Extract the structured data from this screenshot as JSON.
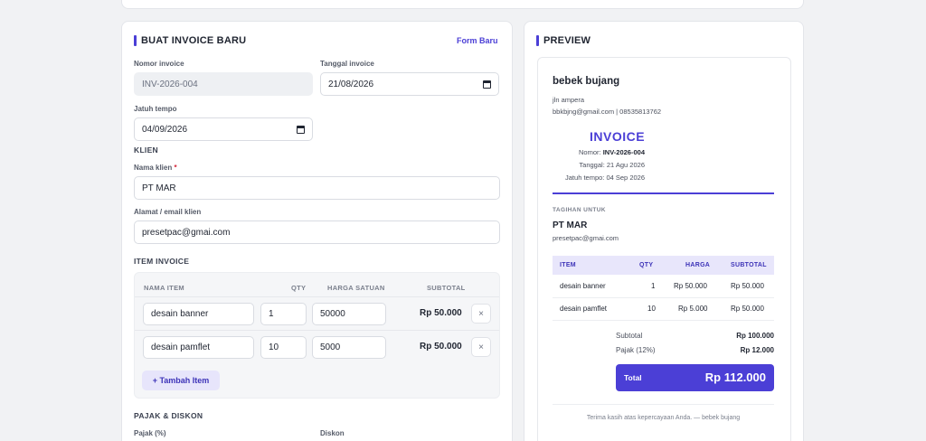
{
  "form": {
    "title": "BUAT INVOICE BARU",
    "new_form_label": "Form Baru",
    "invoice_number_label": "Nomor invoice",
    "invoice_number_value": "INV-2026-004",
    "invoice_date_label": "Tanggal invoice",
    "invoice_date_value": "21/08/2026",
    "due_date_label": "Jatuh tempo",
    "due_date_value": "04/09/2026",
    "client_section": "KLIEN",
    "client_name_label": "Nama klien",
    "required_mark": "*",
    "client_name_value": "PT MAR",
    "client_address_label": "Alamat / email klien",
    "client_address_value": "presetpac@gmai.com",
    "items_section": "ITEM INVOICE",
    "items_headers": {
      "name": "NAMA ITEM",
      "qty": "QTY",
      "price": "HARGA SATUAN",
      "subtotal": "SUBTOTAL"
    },
    "items": [
      {
        "name": "desain banner",
        "qty": "1",
        "price": "50000",
        "subtotal": "Rp 50.000"
      },
      {
        "name": "desain pamflet",
        "qty": "10",
        "price": "5000",
        "subtotal": "Rp 50.000"
      }
    ],
    "remove_symbol": "×",
    "add_item_label": "+ Tambah Item",
    "tax_section": "PAJAK & DISKON",
    "tax_label": "Pajak (%)",
    "discount_label": "Diskon"
  },
  "preview": {
    "title": "PREVIEW",
    "business_name": "bebek bujang",
    "business_address": "jln ampera",
    "business_contact": "bbkbjng@gmail.com | 08535813762",
    "invoice_heading": "INVOICE",
    "number_label": "Nomor:",
    "number_value": "INV-2026-004",
    "date_line": "Tanggal: 21 Agu 2026",
    "due_line": "Jatuh tempo: 04 Sep 2026",
    "bill_to_label": "TAGIHAN UNTUK",
    "client_name": "PT MAR",
    "client_contact": "presetpac@gmai.com",
    "table_headers": {
      "item": "ITEM",
      "qty": "QTY",
      "price": "HARGA",
      "subtotal": "SUBTOTAL"
    },
    "rows": [
      {
        "item": "desain banner",
        "qty": "1",
        "price": "Rp 50.000",
        "subtotal": "Rp 50.000"
      },
      {
        "item": "desain pamflet",
        "qty": "10",
        "price": "Rp 5.000",
        "subtotal": "Rp 50.000"
      }
    ],
    "subtotal_label": "Subtotal",
    "subtotal_value": "Rp 100.000",
    "tax_label": "Pajak (12%)",
    "tax_value": "Rp 12.000",
    "total_label": "Total",
    "total_value": "Rp 112.000",
    "thanks": "Terima kasih atas kepercayaan Anda. — bebek bujang"
  },
  "colors": {
    "accent": "#4b3fd6",
    "accent_soft": "#e7e5fb",
    "required": "#d3263a"
  }
}
